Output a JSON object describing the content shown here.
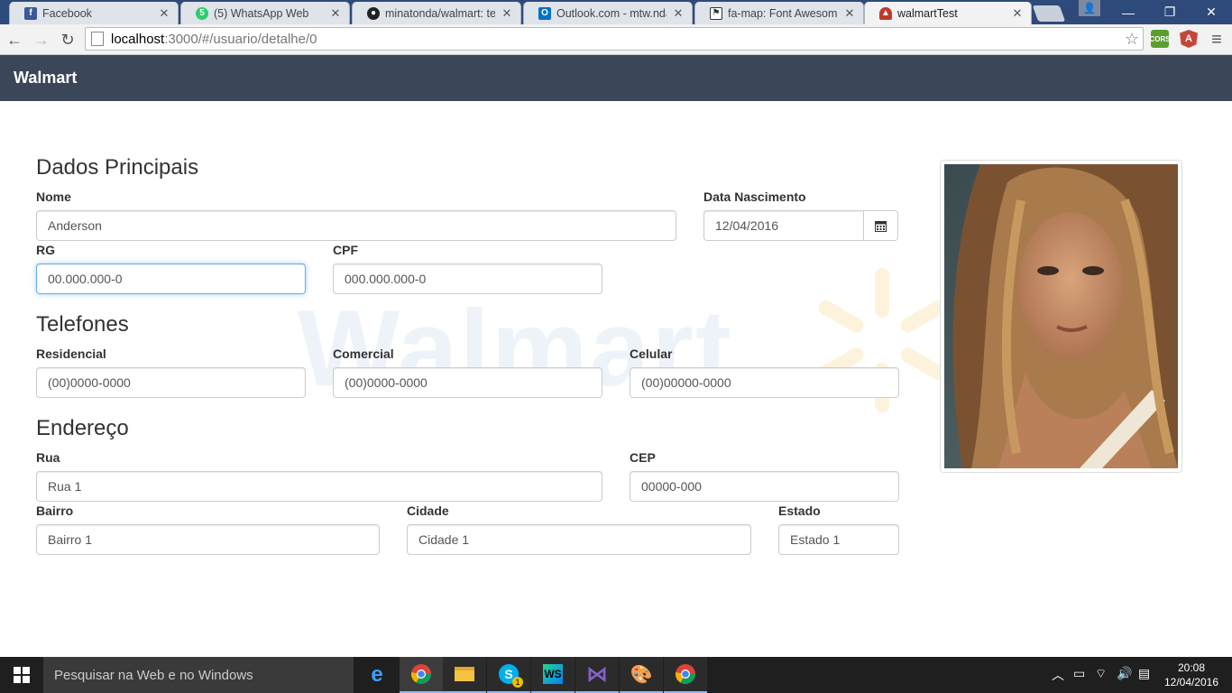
{
  "browser": {
    "tabs": [
      {
        "title": "Facebook",
        "icon": "facebook-icon",
        "color": "#3b5998"
      },
      {
        "title": "(5) WhatsApp Web",
        "icon": "whatsapp-icon",
        "color": "#2ecc71"
      },
      {
        "title": "minatonda/walmart: teste",
        "icon": "github-icon",
        "color": "#222222"
      },
      {
        "title": "Outlook.com - mtw.nda@",
        "icon": "outlook-icon",
        "color": "#0072c6"
      },
      {
        "title": "fa-map: Font Awesome Ic",
        "icon": "fontawesome-icon",
        "color": "#333333"
      },
      {
        "title": "walmartTest",
        "icon": "walmart-hat-icon",
        "color": "#c0392b"
      }
    ],
    "url_host": "localhost",
    "url_rest": ":3000/#/usuario/detalhe/0",
    "extensions": [
      {
        "name": "cors-extension-icon",
        "label": "CORS",
        "color": "#5a9e2f"
      },
      {
        "name": "angular-extension-icon",
        "label": "A",
        "color": "#c4473a"
      }
    ]
  },
  "app": {
    "brand": "Walmart",
    "watermark": "Walmart",
    "sections": {
      "principal": "Dados Principais",
      "telefones": "Telefones",
      "endereco": "Endereço"
    },
    "fields": {
      "nome": {
        "label": "Nome",
        "value": "Anderson"
      },
      "nascimento": {
        "label": "Data Nascimento",
        "value": "12/04/2016"
      },
      "rg": {
        "label": "RG",
        "value": "00.000.000-0"
      },
      "cpf": {
        "label": "CPF",
        "value": "000.000.000-0"
      },
      "residencial": {
        "label": "Residencial",
        "value": "(00)0000-0000"
      },
      "comercial": {
        "label": "Comercial",
        "value": "(00)0000-0000"
      },
      "celular": {
        "label": "Celular",
        "value": "(00)00000-0000"
      },
      "rua": {
        "label": "Rua",
        "value": "Rua 1"
      },
      "cep": {
        "label": "CEP",
        "value": "00000-000"
      },
      "bairro": {
        "label": "Bairro",
        "value": "Bairro 1"
      },
      "cidade": {
        "label": "Cidade",
        "value": "Cidade 1"
      },
      "estado": {
        "label": "Estado",
        "value": "Estado 1"
      }
    }
  },
  "taskbar": {
    "search_placeholder": "Pesquisar na Web e no Windows",
    "time": "20:08",
    "date": "12/04/2016",
    "apps": [
      "edge-icon",
      "chrome-icon",
      "file-explorer-icon",
      "skype-icon",
      "webstorm-icon",
      "visual-studio-icon",
      "paint-icon",
      "chrome-icon"
    ],
    "skype_badge": "1"
  }
}
